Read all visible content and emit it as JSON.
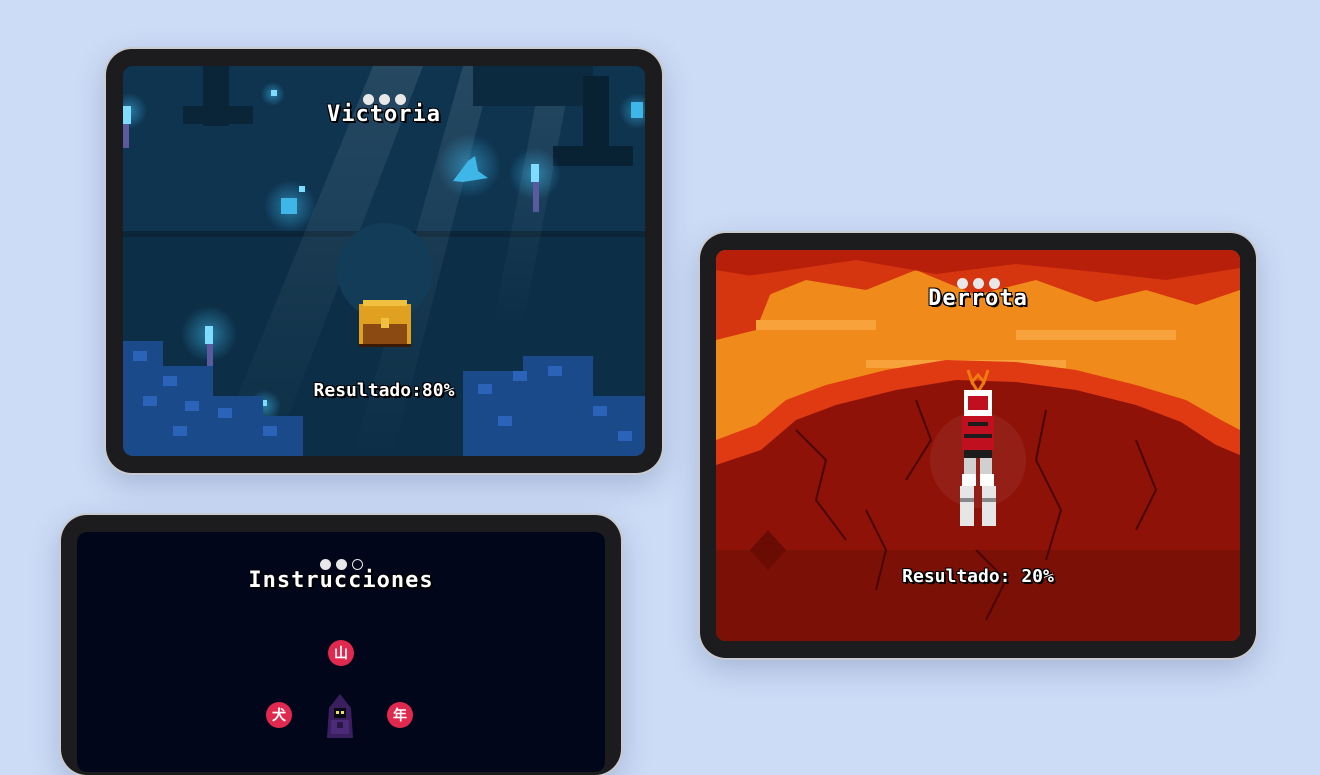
{
  "screens": {
    "victory": {
      "title": "Victoria",
      "progress_dots": [
        true,
        true,
        true
      ],
      "result": "Resultado:80%"
    },
    "defeat": {
      "title": "Derrota",
      "progress_dots": [
        true,
        true,
        true
      ],
      "result": "Resultado: 20%"
    },
    "instructions": {
      "title": "Instrucciones",
      "progress_dots": [
        true,
        true,
        false
      ],
      "kanji": {
        "top": "山",
        "left": "犬",
        "right": "年"
      }
    }
  },
  "colors": {
    "page_background": "#ccdcf6",
    "victory_bg": "#0c2f47",
    "defeat_lava": "#f08a1a",
    "defeat_ground": "#8e1208",
    "instructions_bg": "#02061a",
    "kanji_badge": "#e0294f",
    "glow_cyan": "#3fb6e8"
  }
}
